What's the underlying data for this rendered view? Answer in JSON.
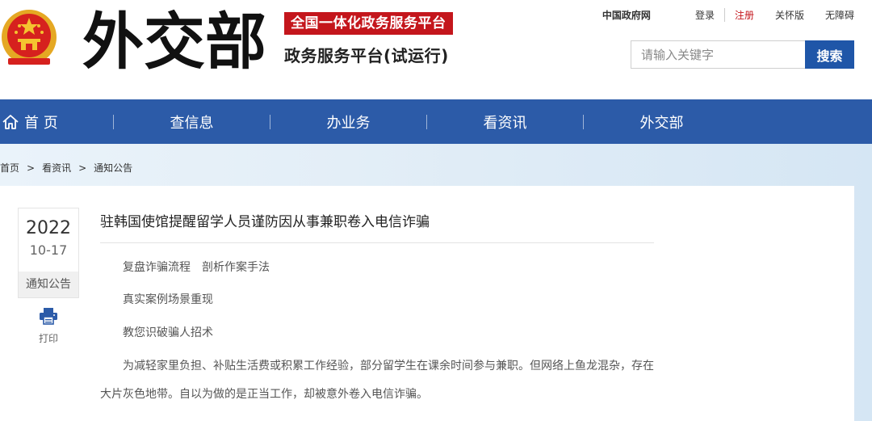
{
  "header": {
    "logo_icon": "national-emblem-icon",
    "calligraphy_text": "外交部",
    "platform_banner": "全国一体化政务服务平台",
    "platform_sub": "政务服务平台(试运行)"
  },
  "top_links": {
    "gov": "中国政府网",
    "login": "登录",
    "register": "注册",
    "care": "关怀版",
    "accessible": "无障碍"
  },
  "search": {
    "placeholder": "请输入关键字",
    "button": "搜索"
  },
  "nav": {
    "home_icon": "home-icon",
    "items": [
      "首 页",
      "查信息",
      "办业务",
      "看资讯",
      "外交部"
    ]
  },
  "breadcrumb": [
    "首页",
    "看资讯",
    "通知公告"
  ],
  "breadcrumb_sep": ">",
  "article": {
    "year": "2022",
    "month_day": "10-17",
    "category": "通知公告",
    "print_icon": "printer-icon",
    "print_label": "打印",
    "title": "驻韩国使馆提醒留学人员谨防因从事兼职卷入电信诈骗",
    "paragraphs": [
      "复盘诈骗流程　剖析作案手法",
      "真实案例场景重现",
      "教您识破骗人招术",
      "为减轻家里负担、补贴生活费或积累工作经验，部分留学生在课余时间参与兼职。但网络上鱼龙混杂，存在大片灰色地带。自以为做的是正当工作，却被意外卷入电信诈骗。"
    ]
  },
  "colors": {
    "nav_blue": "#2c5ba8",
    "search_blue": "#1f56a8",
    "banner_red": "#c4161c"
  }
}
